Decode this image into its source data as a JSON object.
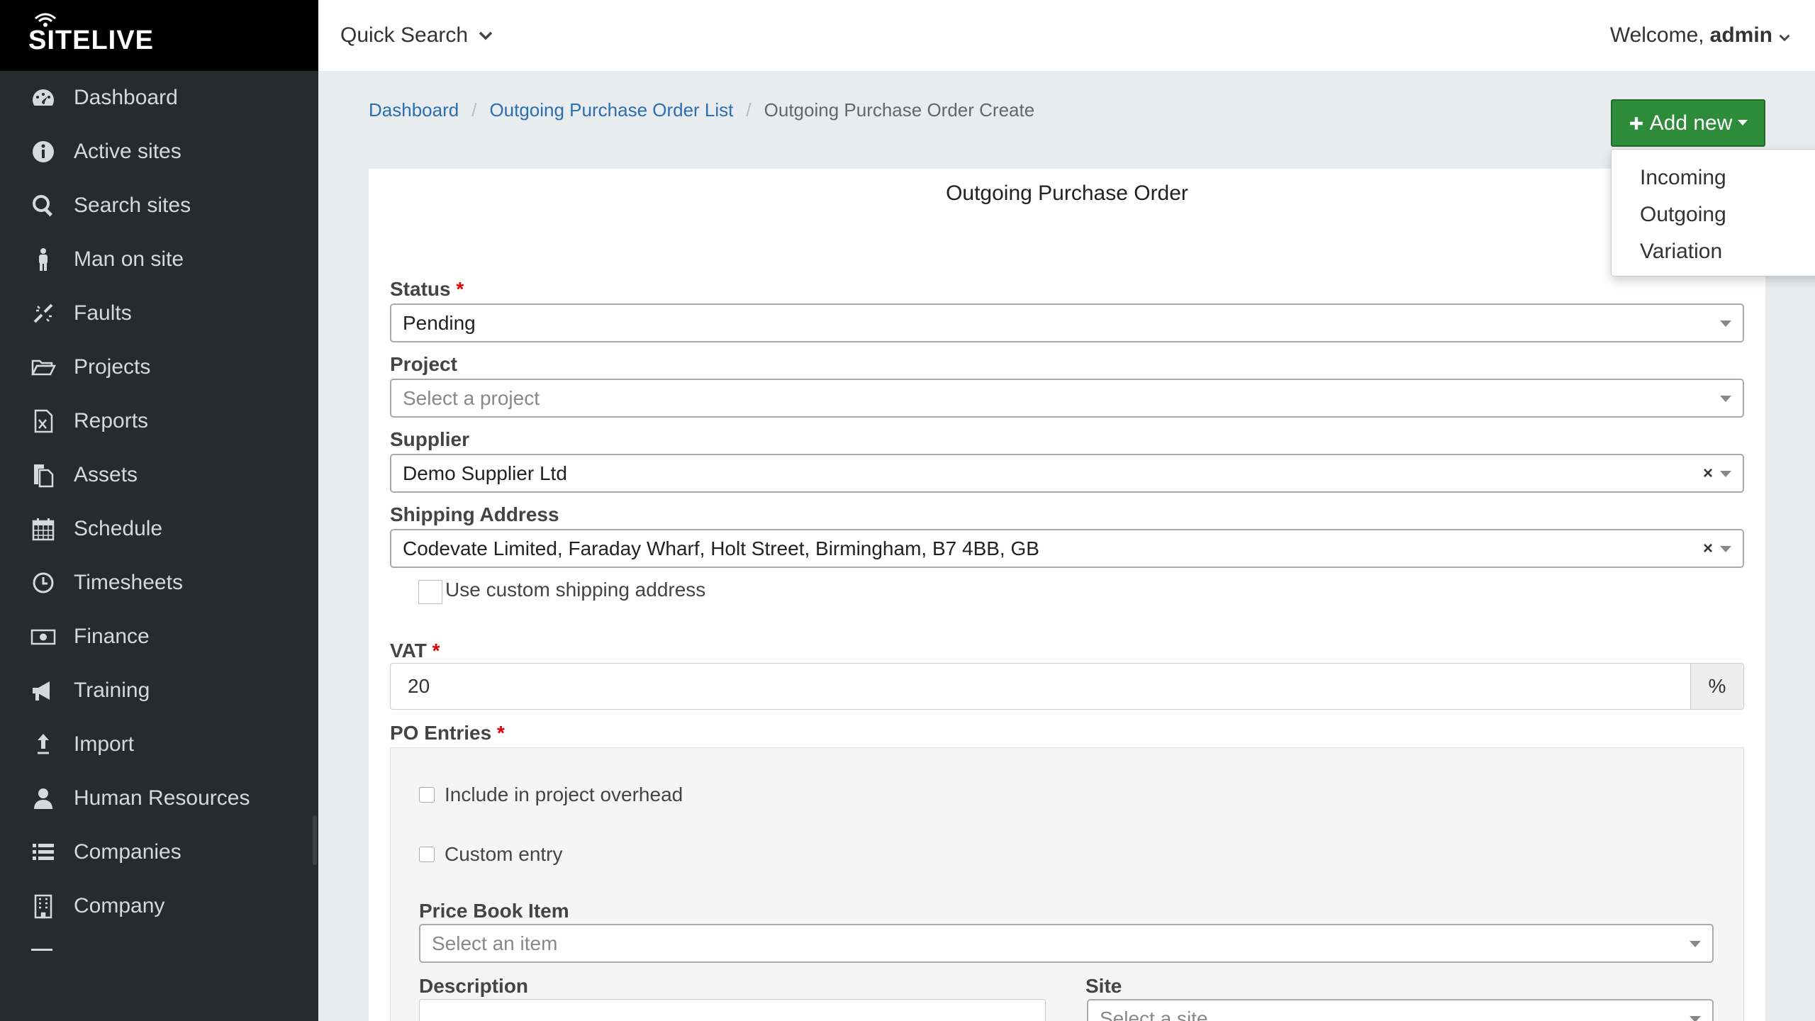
{
  "app": {
    "logo_text": "SITELIVE"
  },
  "sidebar": {
    "items": [
      {
        "label": "Dashboard",
        "icon": "dashboard-icon"
      },
      {
        "label": "Active sites",
        "icon": "info-icon"
      },
      {
        "label": "Search sites",
        "icon": "search-icon"
      },
      {
        "label": "Man on site",
        "icon": "person-icon"
      },
      {
        "label": "Faults",
        "icon": "fault-icon"
      },
      {
        "label": "Projects",
        "icon": "folder-open-icon"
      },
      {
        "label": "Reports",
        "icon": "excel-file-icon"
      },
      {
        "label": "Assets",
        "icon": "files-icon"
      },
      {
        "label": "Schedule",
        "icon": "calendar-icon"
      },
      {
        "label": "Timesheets",
        "icon": "clock-icon"
      },
      {
        "label": "Finance",
        "icon": "money-icon"
      },
      {
        "label": "Training",
        "icon": "megaphone-icon"
      },
      {
        "label": "Import",
        "icon": "upload-arrow-icon"
      },
      {
        "label": "Human Resources",
        "icon": "user-icon"
      },
      {
        "label": "Companies",
        "icon": "list-icon"
      },
      {
        "label": "Company",
        "icon": "building-icon"
      }
    ]
  },
  "topbar": {
    "quick_search": "Quick Search",
    "welcome": "Welcome,",
    "user": "admin"
  },
  "breadcrumb": {
    "home": "Dashboard",
    "list": "Outgoing Purchase Order List",
    "current": "Outgoing Purchase Order Create",
    "separator": "/"
  },
  "add_new": {
    "label": "Add new",
    "menu": [
      "Incoming",
      "Outgoing",
      "Variation"
    ]
  },
  "form": {
    "title": "Outgoing Purchase Order",
    "required_mark": "*",
    "status": {
      "label": "Status",
      "value": "Pending"
    },
    "project": {
      "label": "Project",
      "placeholder": "Select a project"
    },
    "supplier": {
      "label": "Supplier",
      "value": "Demo Supplier Ltd"
    },
    "shipping": {
      "label": "Shipping Address",
      "value": "Codevate Limited, Faraday Wharf, Holt Street, Birmingham, B7 4BB, GB"
    },
    "custom_shipping": "Use custom shipping address",
    "vat": {
      "label": "VAT",
      "value": "20",
      "suffix": "%"
    },
    "po_entries": {
      "label": "PO Entries",
      "include_overhead": "Include in project overhead",
      "custom_entry": "Custom entry",
      "price_book": {
        "label": "Price Book Item",
        "placeholder": "Select an item"
      },
      "description": {
        "label": "Description"
      },
      "site": {
        "label": "Site",
        "placeholder": "Select a site"
      }
    },
    "clear_glyph": "×"
  }
}
